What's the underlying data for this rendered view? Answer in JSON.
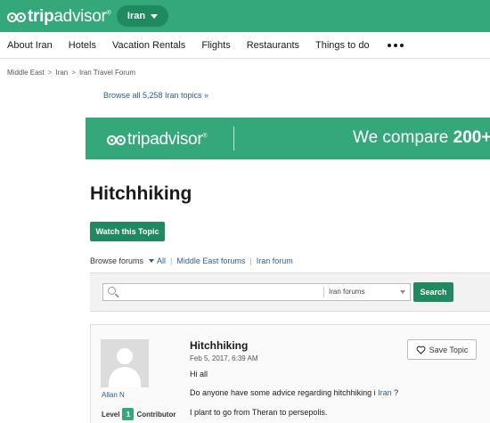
{
  "header": {
    "logo_trip": "trip",
    "logo_advisor": "advisor",
    "logo_reg": "®",
    "geo_label": "Iran"
  },
  "nav": {
    "items": [
      "About Iran",
      "Hotels",
      "Vacation Rentals",
      "Flights",
      "Restaurants",
      "Things to do"
    ]
  },
  "breadcrumb": {
    "items": [
      "Middle East",
      "Iran",
      "Iran Travel Forum"
    ],
    "separator": ">"
  },
  "browse_all_link": "Browse all 5,258 Iran topics »",
  "banner": {
    "logo_trip": "trip",
    "logo_advisor": "advisor",
    "logo_reg": "®",
    "slogan_prefix": "We compare ",
    "slogan_bold": "200+"
  },
  "topic": {
    "title": "Hitchhiking",
    "watch_label": "Watch this Topic"
  },
  "browse_forums": {
    "label": "Browse forums",
    "links": [
      "All",
      "Middle East forums",
      "Iran forum"
    ]
  },
  "search": {
    "placeholder": "",
    "scope": "Iran forums",
    "button": "Search"
  },
  "post": {
    "title": "Hitchhiking",
    "date": "Feb 5, 2017, 6:39 AM",
    "username": "Allan N",
    "level_label": "Level",
    "level_number": "1",
    "level_role": "Contributor",
    "line1": "Hi all",
    "line2_prefix": "Do anyone have some advice regarding hitchhiking i ",
    "line2_link": "Iran",
    "line2_suffix": " ?",
    "line3": "I plant to go from Theran to persepolis.",
    "save_label": "Save Topic"
  },
  "colors": {
    "brand_green": "#34a87a",
    "button_green": "#1f8a5f",
    "link_blue": "#2c5d8a"
  }
}
